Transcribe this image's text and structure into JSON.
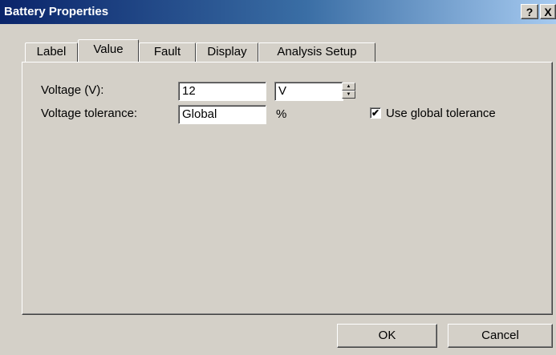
{
  "window": {
    "title": "Battery Properties",
    "help_label": "?",
    "close_label": "X"
  },
  "tabs": [
    {
      "label": "Label",
      "selected": false
    },
    {
      "label": "Value",
      "selected": true
    },
    {
      "label": "Fault",
      "selected": false
    },
    {
      "label": "Display",
      "selected": false
    },
    {
      "label": "Analysis Setup",
      "selected": false
    }
  ],
  "form": {
    "voltage_label": "Voltage (V):",
    "voltage_value": "12",
    "voltage_unit": "V",
    "tolerance_label": "Voltage tolerance:",
    "tolerance_value": "Global",
    "tolerance_unit": "%",
    "use_global_label": "Use global tolerance",
    "use_global_checked": true
  },
  "buttons": {
    "ok": "OK",
    "cancel": "Cancel"
  },
  "colors": {
    "face": "#d4d0c8",
    "title_start": "#0a246a",
    "title_end": "#a6caf0"
  }
}
